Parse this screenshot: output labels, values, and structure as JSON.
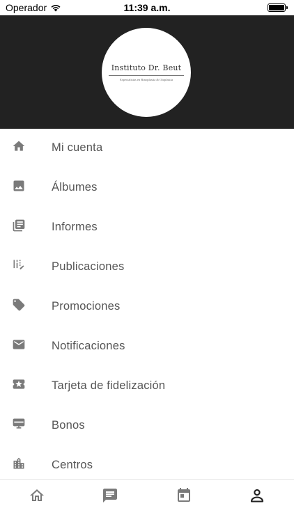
{
  "status_bar": {
    "carrier": "Operador",
    "time": "11:39 a.m."
  },
  "header": {
    "logo_title": "Instituto Dr. Beut",
    "logo_subtitle": "Especialistas en Rinoplastia & Otoplastia"
  },
  "menu": {
    "items": [
      {
        "label": "Mi cuenta",
        "icon": "home-icon"
      },
      {
        "label": "Álbumes",
        "icon": "image-icon"
      },
      {
        "label": "Informes",
        "icon": "library-books-icon"
      },
      {
        "label": "Publicaciones",
        "icon": "edit-list-icon"
      },
      {
        "label": "Promociones",
        "icon": "tag-icon"
      },
      {
        "label": "Notificaciones",
        "icon": "mail-icon"
      },
      {
        "label": "Tarjeta de fidelización",
        "icon": "loyalty-card-icon"
      },
      {
        "label": "Bonos",
        "icon": "voucher-icon"
      },
      {
        "label": "Centros",
        "icon": "building-icon"
      }
    ]
  },
  "tab_bar": {
    "tabs": [
      {
        "icon": "home-outline-icon",
        "active": false
      },
      {
        "icon": "chat-icon",
        "active": false
      },
      {
        "icon": "calendar-icon",
        "active": false
      },
      {
        "icon": "person-icon",
        "active": true
      }
    ],
    "active_color": "#222222",
    "inactive_color": "#7a7a7a"
  },
  "colors": {
    "header_bg": "#222222",
    "icon": "#7a7a7a",
    "label": "#555555"
  }
}
